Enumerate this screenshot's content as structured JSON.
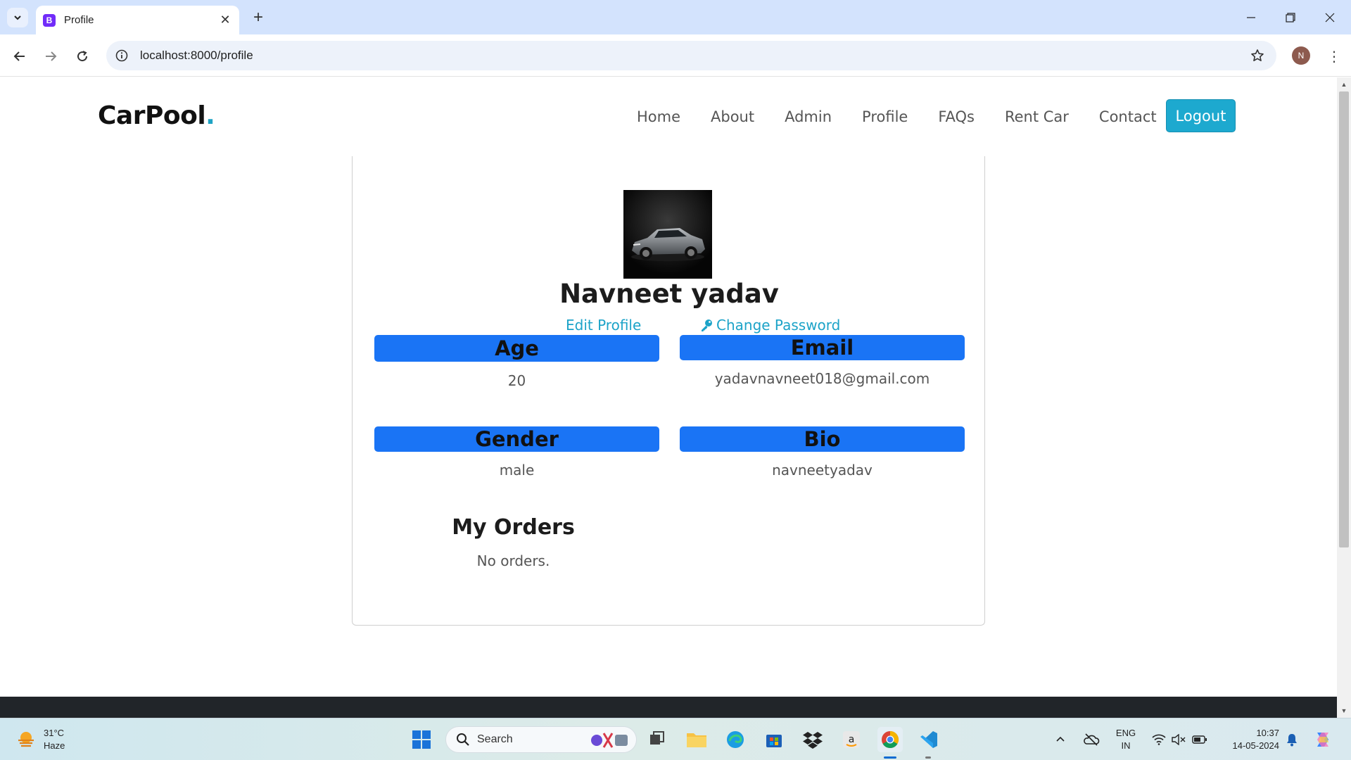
{
  "browser": {
    "tab_title": "Profile",
    "tab_favicon_letter": "B",
    "url": "localhost:8000/profile",
    "profile_initial": "N"
  },
  "site": {
    "brand_name": "CarPool",
    "brand_dot": ".",
    "nav": [
      "Home",
      "About",
      "Admin",
      "Profile",
      "FAQs",
      "Rent Car",
      "Contact"
    ],
    "logout_label": "Logout"
  },
  "profile": {
    "name": "Navneet yadav",
    "edit_profile_label": "Edit Profile",
    "change_password_label": "Change Password",
    "fields": [
      {
        "label": "Age",
        "value": "20"
      },
      {
        "label": "Email",
        "value": "yadavnavneet018@gmail.com"
      },
      {
        "label": "Gender",
        "value": "male"
      },
      {
        "label": "Bio",
        "value": "navneetyadav"
      }
    ],
    "orders_title": "My Orders",
    "orders_empty": "No orders."
  },
  "taskbar": {
    "weather_temp": "31°C",
    "weather_desc": "Haze",
    "search_label": "Search",
    "lang_line1": "ENG",
    "lang_line2": "IN",
    "time": "10:37",
    "date": "14-05-2024"
  },
  "colors": {
    "accent": "#1da9cf",
    "field_header": "#1a74f5",
    "footer": "#212529"
  }
}
